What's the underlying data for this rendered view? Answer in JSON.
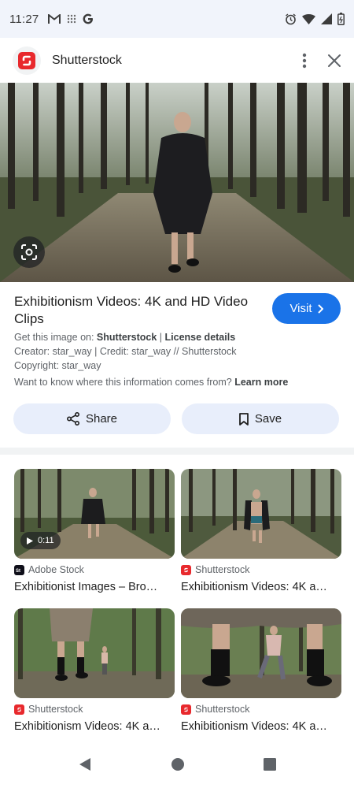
{
  "status_bar": {
    "time": "11:27",
    "left_icons": [
      "gmail-icon",
      "grid-dots-icon",
      "google-icon"
    ],
    "right_icons": [
      "alarm-icon",
      "wifi-icon",
      "signal-icon",
      "battery-icon"
    ]
  },
  "header": {
    "source_name": "Shutterstock",
    "logo_icon": "shutterstock-logo-icon",
    "actions": [
      "more-vertical-icon",
      "close-icon"
    ]
  },
  "hero": {
    "lens_icon": "lens-icon"
  },
  "info": {
    "title": "Exhibitionism Videos: 4K and HD Video Clips",
    "visit_label": "Visit",
    "get_image_prefix": "Get this image on: ",
    "get_image_source": "Shutterstock",
    "separator": " | ",
    "license_link": "License details",
    "creator_line": "Creator: star_way | Credit: star_way // Shutterstock",
    "copyright_line": "Copyright: star_way",
    "want_to_know": "Want to know where this information comes from? ",
    "learn_more": "Learn more",
    "share_label": "Share",
    "save_label": "Save"
  },
  "related": [
    {
      "source": "Adobe Stock",
      "title": "Exhibitionist Images – Bro…",
      "duration": "0:11",
      "logo_color": "#0f0f1a"
    },
    {
      "source": "Shutterstock",
      "title": "Exhibitionism Videos: 4K a…",
      "logo_color": "#e8292d"
    },
    {
      "source": "Shutterstock",
      "title": "Exhibitionism Videos: 4K a…",
      "logo_color": "#e8292d"
    },
    {
      "source": "Shutterstock",
      "title": "Exhibitionism Videos: 4K a…",
      "logo_color": "#e8292d"
    }
  ],
  "nav": [
    "back-icon",
    "home-icon",
    "recents-icon"
  ],
  "colors": {
    "accent": "#1a73e8",
    "pill_bg": "#e8eefb",
    "shutterstock_red": "#e8292d"
  }
}
